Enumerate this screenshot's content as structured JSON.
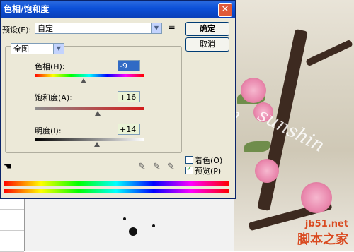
{
  "dialog": {
    "title": "色相/饱和度",
    "close_glyph": "✕",
    "preset_label": "预设(E):",
    "preset_value": "自定",
    "preset_menu_glyph": "≡",
    "ok_label": "确定",
    "cancel_label": "取消",
    "channel_value": "全图",
    "hue_label": "色相(H):",
    "hue_value": "-9",
    "hue_position": 0.45,
    "saturation_label": "饱和度(A):",
    "saturation_value": "+16",
    "saturation_position": 0.58,
    "lightness_label": "明度(I):",
    "lightness_value": "+14",
    "lightness_position": 0.57,
    "colorize_label": "着色(O)",
    "colorize_checked": false,
    "preview_label": "预览(P)",
    "preview_checked": true,
    "hand_tool_glyph": "☚"
  },
  "photo": {
    "watermark": "sunshin",
    "watermark2": "n",
    "site_url": "jb51.net",
    "site_name": "脚本之家"
  }
}
